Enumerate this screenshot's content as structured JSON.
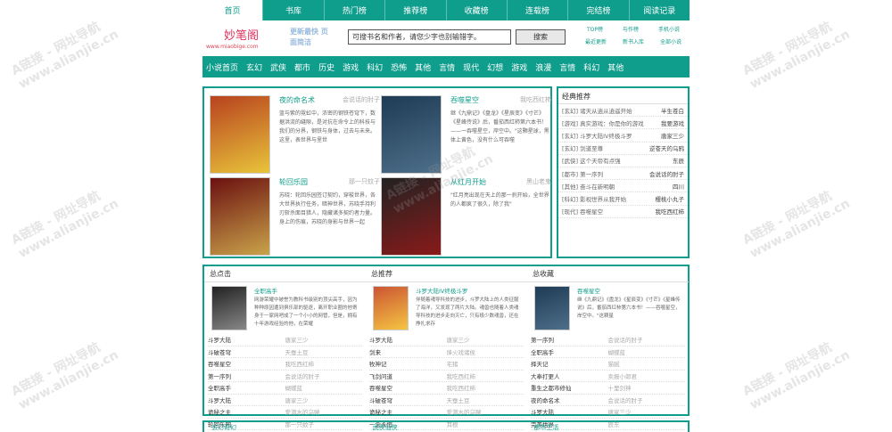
{
  "topnav": [
    "首页",
    "书库",
    "热门榜",
    "推荐榜",
    "收藏榜",
    "连载榜",
    "完结榜",
    "阅读记录"
  ],
  "header": {
    "logo_title": "妙笔阁",
    "logo_url": "www.miaobige.com",
    "logo_slogan": "更新最快 页面简洁",
    "search_value": "可搜书名和作者，请您少字也别输错字。",
    "search_button": "搜索",
    "links_row1": [
      "TOP榜",
      "与作榜",
      "手机小说"
    ],
    "links_row2": [
      "最近更新",
      "新书入库",
      "全部小说"
    ]
  },
  "catnav": [
    "小说首页",
    "玄幻",
    "武侠",
    "都市",
    "历史",
    "游戏",
    "科幻",
    "恐怖",
    "其他",
    "言情",
    "现代",
    "幻想",
    "游戏",
    "浪漫",
    "言情",
    "科幻",
    "其他"
  ],
  "features": [
    {
      "title": "夜的命名术",
      "author": "会说话的肘子",
      "desc": "蓝与紫的霓虹中，浓密的钢铁苍穹下，数据洪流的缝隙，是对抗在命令上的科技与我们的分界，钢铁与身体，过去与未来。这里，表世界与里世"
    },
    {
      "title": "吞噬星空",
      "author": "我吃西红柿",
      "desc": "继《九鼎记》《盘龙》《星辰变》《寸芒》《星峰传说》后，番茄西红柿第六本书！——一吞噬星空，岸空中。\"这颗星球，黑体上黄色，没有什么可吞噬"
    },
    {
      "title": "轮回乐园",
      "author": "那一只蚊子",
      "desc": "苏晓：轮回乐园签订契约，穿梭世界，各大世界执行任务，暗神世界，苏晓手持利刃斩杀面目猎人，隐藏诸多契约者力量。身上的伤痕，苏晓的身影与世界一起"
    },
    {
      "title": "从红月开始",
      "author": "黑山老鬼",
      "desc": "\"红月亮出现在天上的那一刹开始，全世界的人都疯了很久，除了我\""
    }
  ],
  "recommend": {
    "heading": "经典推荐",
    "rows": [
      [
        "[玄幻] 诸天从逍从逍遥开始",
        "半生苍白"
      ],
      [
        "[游戏] 真实游戏：你是你的游戏",
        "我要游戏"
      ],
      [
        "[玄幻] 斗罗大陆IV终极斗罗",
        "唐家三少"
      ],
      [
        "[玄幻] 剑道至尊",
        "逆苍天的乌鸦"
      ],
      [
        "[武侠] 这个天帝有点强",
        "东辰"
      ],
      [
        "[都市] 第一序列",
        "会说话的肘子"
      ],
      [
        "[其他] 奋斗在新明朝",
        "四川"
      ],
      [
        "[科幻] 影视世界从我开始",
        "樱桃小丸子"
      ],
      [
        "[现代] 吞噬星空",
        "我吃西红柿"
      ]
    ]
  },
  "cols": [
    {
      "heading": "总点击",
      "mini_title": "全职高手",
      "mini_desc": "网游荣耀中被誉为教科书级别的顶尖高手，因为种种原因遭到俱乐部的驱逐，离开职业圈的他寄身于一家网吧成了一个小小的网管，但是，拥有十年游戏经验的他，在荣耀",
      "rows": [
        [
          "斗罗大陆",
          "唐家三少"
        ],
        [
          "斗破苍穹",
          "天蚕土豆"
        ],
        [
          "吞噬星空",
          "我吃西红柿"
        ],
        [
          "第一序列",
          "会说话的肘子"
        ],
        [
          "全职高手",
          "蝴蝶蓝"
        ],
        [
          "斗罗大陆",
          "唐家三少"
        ],
        [
          "诡秘之主",
          "爱潜水的乌贼"
        ],
        [
          "轮回乐园",
          "那一只蚊子"
        ]
      ]
    },
    {
      "heading": "总推荐",
      "mini_title": "斗罗大陆IV终极斗罗",
      "mini_desc": "伴随着魂导科技的进步，斗罗大陆上的人类征服了海洋，又发现了两片大陆。魂兽也随着人类魂导科技的进步走向灭亡，只有极少数魂兽，还在挣扎求存",
      "rows": [
        [
          "斗罗大陆",
          "唐家三少"
        ],
        [
          "剑来",
          "烽火戏诸侯"
        ],
        [
          "牧神记",
          "宅猪"
        ],
        [
          "飞剑问道",
          "我吃西红柿"
        ],
        [
          "吞噬星空",
          "我吃西红柿"
        ],
        [
          "斗破苍穹",
          "天蚕土豆"
        ],
        [
          "诡秘之主",
          "爱潜水的乌贼"
        ],
        [
          "一念永恒",
          "耳根"
        ]
      ]
    },
    {
      "heading": "总收藏",
      "mini_title": "吞噬星空",
      "mini_desc": "继《九鼎记》《盘龙》《星辰变》《寸芒》《星峰传说》后，番茄西红柿第六本书！——吞噬星空，岸空中。\"这颗星",
      "rows": [
        [
          "第一序列",
          "会说话的肘子"
        ],
        [
          "全职高手",
          "蝴蝶蓝"
        ],
        [
          "择天记",
          "猫腻"
        ],
        [
          "大奉打更人",
          "卖报小郎君"
        ],
        [
          "重生之都市修仙",
          "十里剑神"
        ],
        [
          "夜的命名术",
          "会说话的肘子"
        ],
        [
          "斗罗大陆",
          "唐家三少"
        ],
        [
          "完美世界",
          "辰东"
        ]
      ]
    }
  ],
  "bottom": [
    "玄幻奇幻",
    "武侠仙侠",
    "都市生活"
  ],
  "watermark": "A链接 - 网址导航",
  "watermark_url": "www.alianjie.cn"
}
